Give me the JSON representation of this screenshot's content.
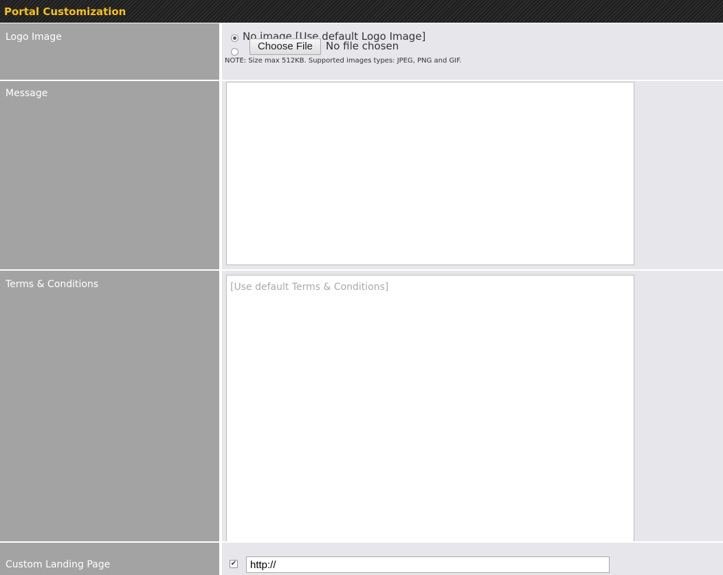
{
  "section": {
    "title": "Portal Customization"
  },
  "logo_image": {
    "label": "Logo Image",
    "option_default": "No image [Use default Logo Image]",
    "option_default_selected": true,
    "choose_file_label": "Choose File",
    "file_status": "No file chosen",
    "note": "NOTE: Size max 512KB. Supported images types: JPEG, PNG and GIF."
  },
  "message": {
    "label": "Message",
    "value": ""
  },
  "terms": {
    "label": "Terms & Conditions",
    "placeholder": "[Use default Terms & Conditions]"
  },
  "landing_page": {
    "label": "Custom Landing Page",
    "enabled": true,
    "checkmark": "✔",
    "url_value": "http://"
  },
  "colors": {
    "header_bg": "#1c1c1c",
    "header_text": "#f5c116",
    "label_bg": "#a3a3a3",
    "value_bg": "#e6e6eb"
  }
}
